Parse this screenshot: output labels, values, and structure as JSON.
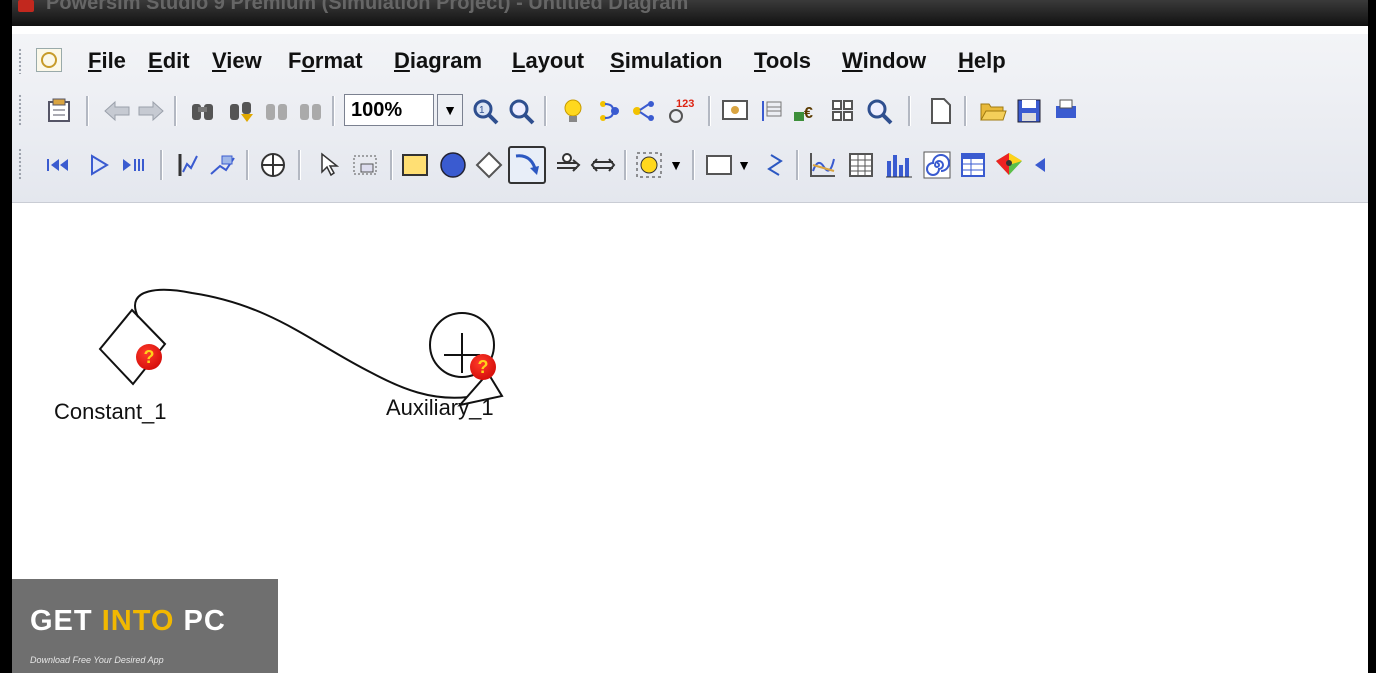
{
  "titlebar": {
    "text": "Powersim Studio 9 Premium (Simulation Project) - Untitled Diagram"
  },
  "menu": [
    {
      "name": "File",
      "ul": "F",
      "rest": "ile"
    },
    {
      "name": "Edit",
      "ul": "E",
      "rest": "dit"
    },
    {
      "name": "View",
      "ul": "V",
      "rest": "iew"
    },
    {
      "name": "Format",
      "pre": "F",
      "ul": "o",
      "rest": "rmat"
    },
    {
      "name": "Diagram",
      "ul": "D",
      "rest": "iagram"
    },
    {
      "name": "Layout",
      "ul": "L",
      "rest": "ayout"
    },
    {
      "name": "Simulation",
      "ul": "S",
      "rest": "imulation"
    },
    {
      "name": "Tools",
      "ul": "T",
      "rest": "ools"
    },
    {
      "name": "Window",
      "ul": "W",
      "rest": "indow"
    },
    {
      "name": "Help",
      "ul": "H",
      "rest": "elp"
    }
  ],
  "toolbar": {
    "zoom_value": "100%"
  },
  "diagram": {
    "constant_label": "Constant_1",
    "auxiliary_label": "Auxiliary_1",
    "badge_glyph": "?"
  },
  "watermark": {
    "word1": "GET",
    "word2": "INTO",
    "word3": "PC",
    "tagline": "Download Free Your Desired App"
  }
}
